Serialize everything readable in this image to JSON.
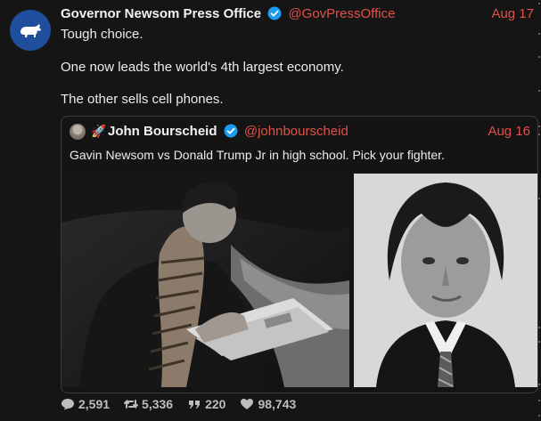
{
  "tweet": {
    "author_name": "Governor Newsom Press Office",
    "handle": "@GovPressOffice",
    "date": "Aug 17",
    "lines": [
      "Tough choice.",
      "One now leads the world's 4th largest economy.",
      "The other sells cell phones."
    ]
  },
  "quoted": {
    "author_name": "John Bourscheid",
    "handle": "@johnbourscheid",
    "date": "Aug 16",
    "text": "Gavin Newsom vs Donald Trump Jr in high school. Pick your fighter.",
    "emoji": "🚀"
  },
  "stats": {
    "replies": "2,591",
    "retweets": "5,336",
    "quotes": "220",
    "likes": "98,743"
  },
  "colors": {
    "accent": "#e0504a",
    "verified": "#1d9bf0",
    "avatar_bg": "#1f4e9c"
  },
  "icons": {
    "avatar": "california-bear-icon",
    "verified": "verified-badge-icon",
    "reply": "comment-icon",
    "retweet": "retweet-icon",
    "quote": "quote-icon",
    "like": "heart-icon"
  }
}
